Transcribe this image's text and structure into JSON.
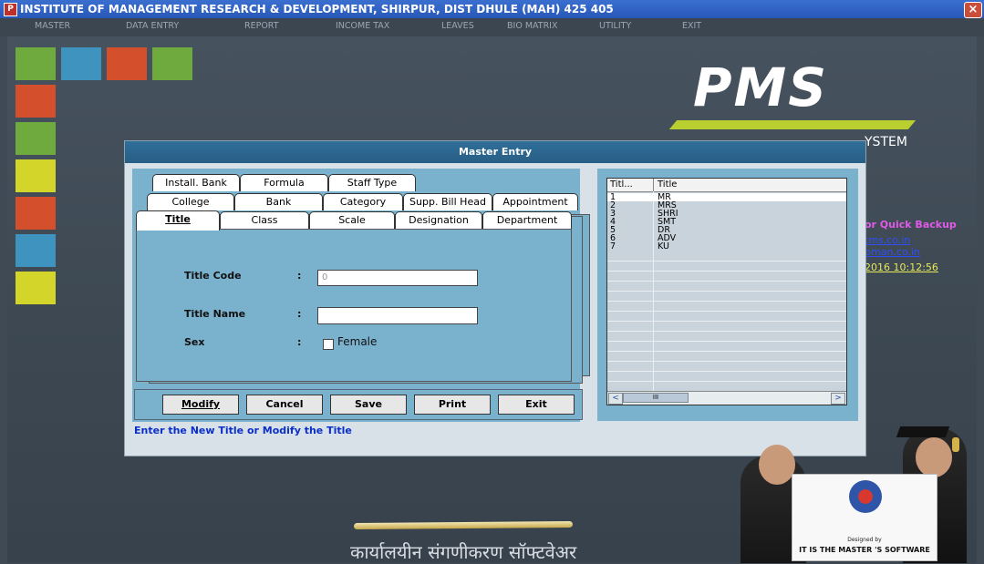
{
  "window": {
    "title": "INSTITUTE OF MANAGEMENT RESEARCH & DEVELOPMENT, SHIRPUR, DIST DHULE (MAH) 425 405",
    "app_icon": "P",
    "close": "×"
  },
  "menu": [
    "MASTER",
    "DATA ENTRY",
    "REPORT",
    "INCOME TAX",
    "LEAVES",
    "BIO MATRIX",
    "UTILITY",
    "EXIT"
  ],
  "branding": {
    "logo": "PMS",
    "subtitle_tail": "YSTEM",
    "hindi_tagline": "कार्यालयीन संगणीकरण सॉफ्टवेअर",
    "designed_by": "Designed by",
    "company": "IT IS THE MASTER 'S SOFTWARE"
  },
  "sidebar": {
    "backup": "or Quick Backup",
    "link1": "tms.co.in",
    "link2": "bman.co.in",
    "datetime": "2016 10:12:56"
  },
  "dialog": {
    "title": "Master Entry",
    "tabs_row1": [
      "Install. Bank",
      "Formula",
      "Staff Type"
    ],
    "tabs_row2": [
      "College",
      "Bank",
      "Category",
      "Supp. Bill Head",
      "Appointment"
    ],
    "tabs_row3": [
      "Title",
      "Class",
      "Scale",
      "Designation",
      "Department"
    ],
    "form": {
      "code_label": "Title Code",
      "code_value": "0",
      "name_label": "Title Name",
      "name_value": "",
      "sex_label": "Sex",
      "sex_option": "Female",
      "colon": ":"
    },
    "buttons": [
      "Modify",
      "Cancel",
      "Save",
      "Print",
      "Exit"
    ],
    "status": "Enter the New Title or Modify the Title",
    "grid": {
      "columns": [
        "Titl...",
        "Title"
      ],
      "rows": [
        [
          "1",
          "MR"
        ],
        [
          "2",
          "MRS"
        ],
        [
          "3",
          "SHRI"
        ],
        [
          "4",
          "SMT"
        ],
        [
          "5",
          "DR"
        ],
        [
          "6",
          "ADV"
        ],
        [
          "7",
          "KU"
        ]
      ],
      "scroll_left": "<",
      "scroll_right": ">",
      "thumb_grip": "III"
    }
  },
  "colors": {
    "titlebar": "#2f62c4",
    "dialog_accent": "#7ab1cd",
    "status_text": "#0a2fc8"
  }
}
